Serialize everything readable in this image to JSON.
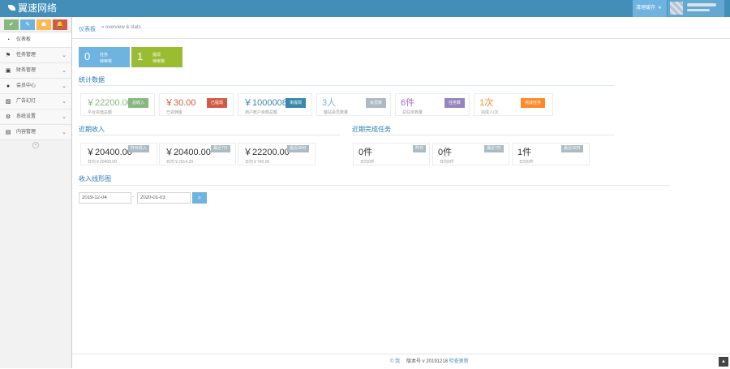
{
  "brand": {
    "name": "翼速网络"
  },
  "header": {
    "action_label": "清理缓存",
    "user_line1": "",
    "user_line2": ""
  },
  "shortcuts": [
    "✔",
    "✎",
    "☗",
    "🔔"
  ],
  "sidebar": {
    "items": [
      {
        "label": "仪表板",
        "icon": "tachometer-icon"
      },
      {
        "label": "任务管理",
        "icon": "flag-icon"
      },
      {
        "label": "财务管理",
        "icon": "wallet-icon"
      },
      {
        "label": "会员中心",
        "icon": "user-icon"
      },
      {
        "label": "广告幻灯",
        "icon": "picture-icon"
      },
      {
        "label": "系统设置",
        "icon": "cogs-icon"
      },
      {
        "label": "内容管理",
        "icon": "book-icon"
      }
    ]
  },
  "breadcrumb": {
    "title": "仪表板",
    "sub": "» overview & stats"
  },
  "infoboxes": [
    {
      "number": "0",
      "line1": "任务",
      "line2": "待审核"
    },
    {
      "number": "1",
      "line1": "提现",
      "line2": "待审核"
    }
  ],
  "stats_section": {
    "title": "统计数据",
    "items": [
      {
        "value": "￥22200.00",
        "sub": "平台充值总额",
        "flag": "总收入"
      },
      {
        "value": "￥30.00",
        "sub": "已返佣金",
        "flag": "已提现"
      },
      {
        "value": "￥1000008",
        "sub": "用户账户余额总额",
        "flag": "未提现"
      },
      {
        "value": "3人",
        "sub": "整站会员数量",
        "flag": "会员数"
      },
      {
        "value": "6件",
        "sub": "总任务数量",
        "flag": "任务数"
      },
      {
        "value": "1次",
        "sub": "完成人/次",
        "flag": "完成任务"
      }
    ]
  },
  "income_section": {
    "title": "近期收入",
    "items": [
      {
        "value": "￥20400.00",
        "tag": "昨日收入",
        "sub": "日均￥20400.00"
      },
      {
        "value": "￥20400.00",
        "tag": "最近7日",
        "sub": "日均￥2914.29"
      },
      {
        "value": "￥22200.00",
        "tag": "最近30日",
        "sub": "日均￥740.00"
      }
    ]
  },
  "task_section": {
    "title": "近期完成任务",
    "items": [
      {
        "value": "0件",
        "tag": "昨日",
        "sub": "日均0件"
      },
      {
        "value": "0件",
        "tag": "最近7日",
        "sub": "日均0件"
      },
      {
        "value": "1件",
        "tag": "最近30日",
        "sub": "日均0件"
      }
    ]
  },
  "chart_section": {
    "title": "收入线形图",
    "date_start": "2019-12-04",
    "date_end": "2020-01-03",
    "separator": "-"
  },
  "footer": {
    "copyright": "© 我",
    "version_label": "版本号 v 20191218",
    "update_link": "检查更新"
  },
  "colors": {
    "header": "#438eb9",
    "green": "#87b87f",
    "red": "#d15b47",
    "blue": "#3a87ad",
    "grey": "#abbac3",
    "purple": "#9585bf",
    "orange": "#ff892a",
    "infobox_blue": "#6fb3e0",
    "infobox_green": "#9abc32"
  }
}
